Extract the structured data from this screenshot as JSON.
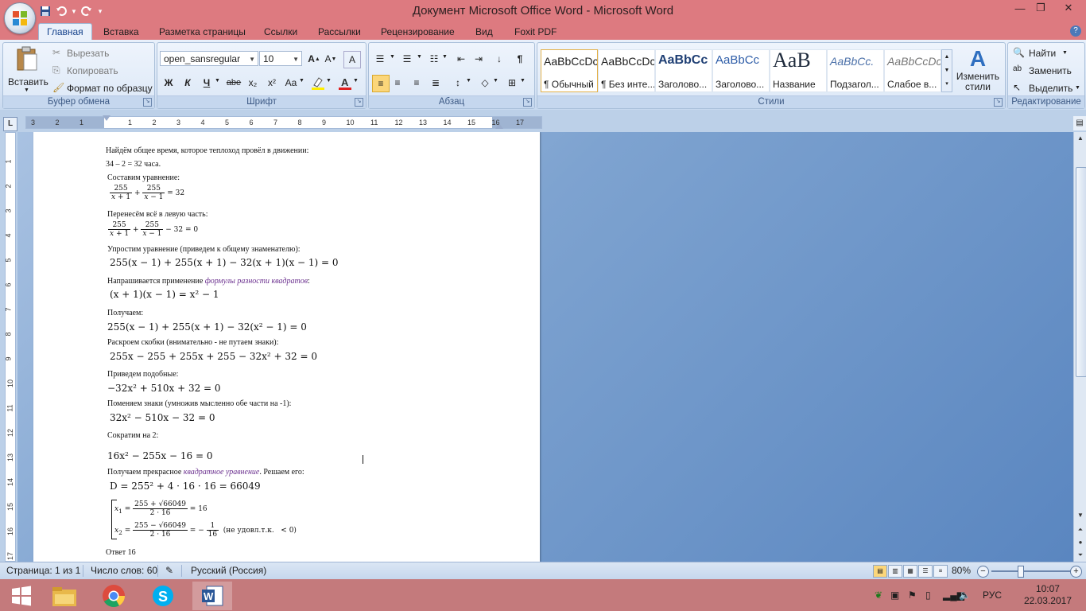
{
  "window": {
    "title": "Документ Microsoft Office Word - Microsoft Word"
  },
  "tabs": [
    "Главная",
    "Вставка",
    "Разметка страницы",
    "Ссылки",
    "Рассылки",
    "Рецензирование",
    "Вид",
    "Foxit PDF"
  ],
  "ribbon": {
    "clipboard": {
      "paste": "Вставить",
      "cut": "Вырезать",
      "copy": "Копировать",
      "format_painter": "Формат по образцу",
      "label": "Буфер обмена"
    },
    "font": {
      "name": "open_sansregular",
      "size": "10",
      "bold": "Ж",
      "italic": "К",
      "underline": "Ч",
      "strike": "abe",
      "sub": "x₂",
      "sup": "x²",
      "case": "Aa",
      "label": "Шрифт"
    },
    "paragraph": {
      "label": "Абзац"
    },
    "styles": {
      "items": [
        {
          "preview": "AaBbCcDc",
          "name": "¶ Обычный"
        },
        {
          "preview": "AaBbCcDc",
          "name": "¶ Без инте..."
        },
        {
          "preview": "AaBbCc",
          "name": "Заголово..."
        },
        {
          "preview": "AaBbCc",
          "name": "Заголово..."
        },
        {
          "preview": "AaB",
          "name": "Название"
        },
        {
          "preview": "AaBbCc.",
          "name": "Подзагол..."
        },
        {
          "preview": "AaBbCcDc",
          "name": "Слабое в..."
        }
      ],
      "change": "Изменить стили",
      "label": "Стили"
    },
    "editing": {
      "find": "Найти",
      "replace": "Заменить",
      "select": "Выделить",
      "label": "Редактирование"
    }
  },
  "document": {
    "l1": "Найдём общее время, которое теплоход провёл в движении:",
    "l2": "34 – 2 = 32 часа.",
    "l3": "Составим уравнение:",
    "l4": "Перенесём всё в левую часть:",
    "l5": "Упростим уравнение (приведем к общему знаменателю):",
    "m5": "255(x − 1) + 255(x + 1) − 32(x + 1)(x − 1) = 0",
    "l6a": "Напрашивается применение ",
    "l6link": "формулы разности квадратов",
    "l6b": ":",
    "m6": "(x + 1)(x − 1) = x² − 1",
    "l7": "Получаем:",
    "m7": "255(x − 1) + 255(x + 1) − 32(x² − 1) = 0",
    "l8": "Раскроем скобки (внимательно - не путаем знаки):",
    "m8": "255x − 255 + 255x + 255 − 32x² + 32 = 0",
    "l9": "Приведем подобные:",
    "m9": "−32x² + 510x + 32 = 0",
    "l10": "Поменяем знаки (умножив мысленно обе части на -1):",
    "m10": "32x² − 510x − 32 = 0",
    "l11": "Сократим на 2:",
    "m11": "16x² − 255x − 16 = 0",
    "l12a": "Получаем прекрасное ",
    "l12link": "квадратное уравнение",
    "l12b": ". Решаем его:",
    "m12": "D = 255² + 4 · 16 · 16 = 66049",
    "answer": "Ответ 16"
  },
  "status": {
    "page": "Страница: 1 из 1",
    "words": "Число слов: 60",
    "lang": "Русский (Россия)",
    "zoom": "80%"
  },
  "taskbar": {
    "lang": "РУС",
    "time": "10:07",
    "date": "22.03.2017"
  }
}
